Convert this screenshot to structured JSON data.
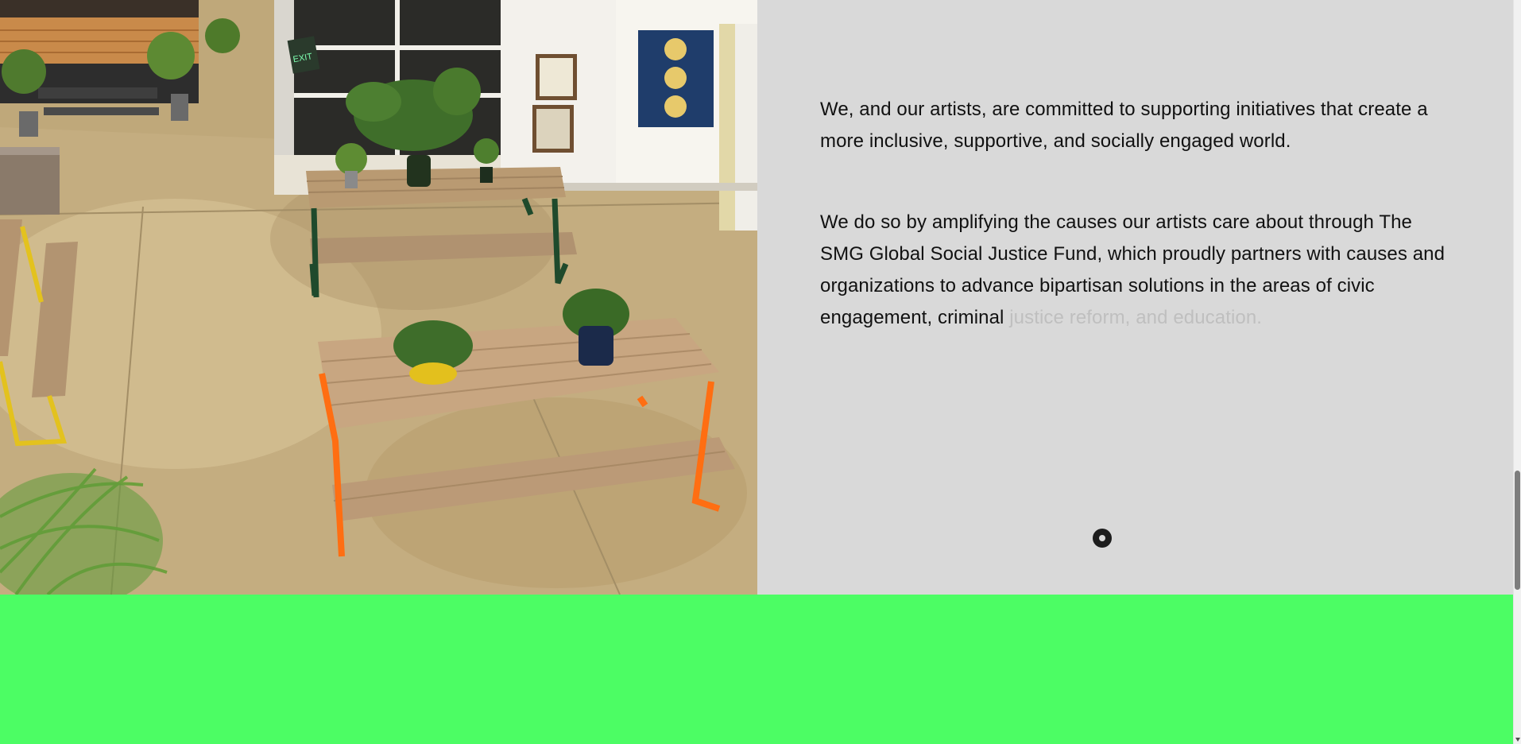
{
  "content": {
    "paragraph_1": "We, and our artists, are committed to supporting initiatives that create a more inclusive, supportive, and socially engaged world.",
    "paragraph_2_visible": "We do so by amplifying the causes our artists care about through The SMG Global Social Justice Fund, which proudly partners with causes and organizations to advance bipartisan solutions in the areas of civic engagement, criminal ",
    "paragraph_2_faded": "justice reform, and education."
  },
  "photo": {
    "sign_text": "EXIT",
    "description_icon": "office-courtyard-picnic-tables-image"
  },
  "colors": {
    "panel_background": "#d9d9d9",
    "text": "#111111",
    "faded_text": "#bfbfbf",
    "band": "#4cfd64"
  },
  "indicator": {
    "icon": "record-dot-icon"
  },
  "scrollbar": {
    "position_fraction": 0.82
  }
}
